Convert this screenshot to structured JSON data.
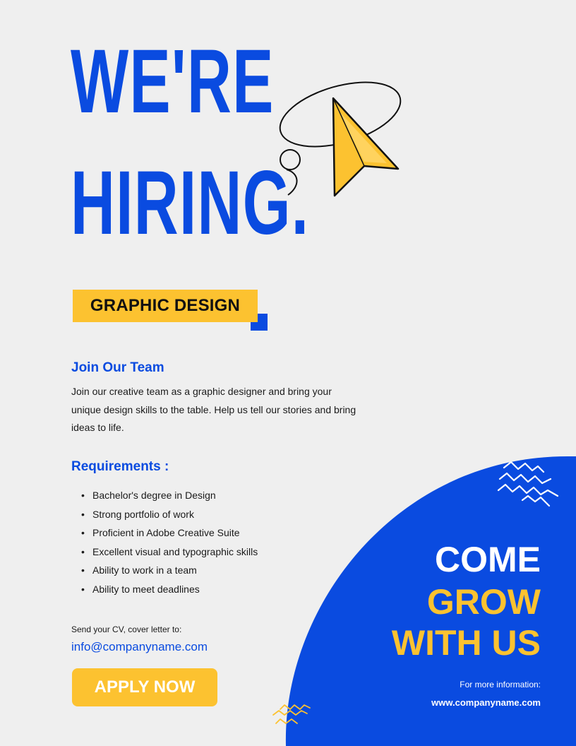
{
  "headline": {
    "line1": "WE'RE",
    "line2": "HIRING."
  },
  "position_tag": "GRAPHIC DESIGN",
  "join": {
    "title": "Join Our Team",
    "text": "Join our creative team as a graphic designer and bring your unique design skills to the table. Help us tell our stories and bring ideas to life."
  },
  "requirements": {
    "title": "Requirements :",
    "items": [
      "Bachelor's degree in Design",
      "Strong portfolio of work",
      "Proficient in Adobe Creative Suite",
      "Excellent visual and typographic skills",
      "Ability to work in a team",
      "Ability to meet deadlines"
    ]
  },
  "contact": {
    "send_text": "Send your CV, cover letter to:",
    "email": "info@companyname.com",
    "apply_label": "APPLY NOW"
  },
  "cta": {
    "line1": "COME",
    "line2": "GROW",
    "line3": "WITH US",
    "more_info": "For more information:",
    "website": "www.companyname.com"
  },
  "icons": [
    "cursor-arrow-icon",
    "zigzag-icon"
  ],
  "colors": {
    "background": "#efefef",
    "blue": "#0a4be0",
    "yellow": "#fcc230",
    "text": "#1a1a1a"
  }
}
